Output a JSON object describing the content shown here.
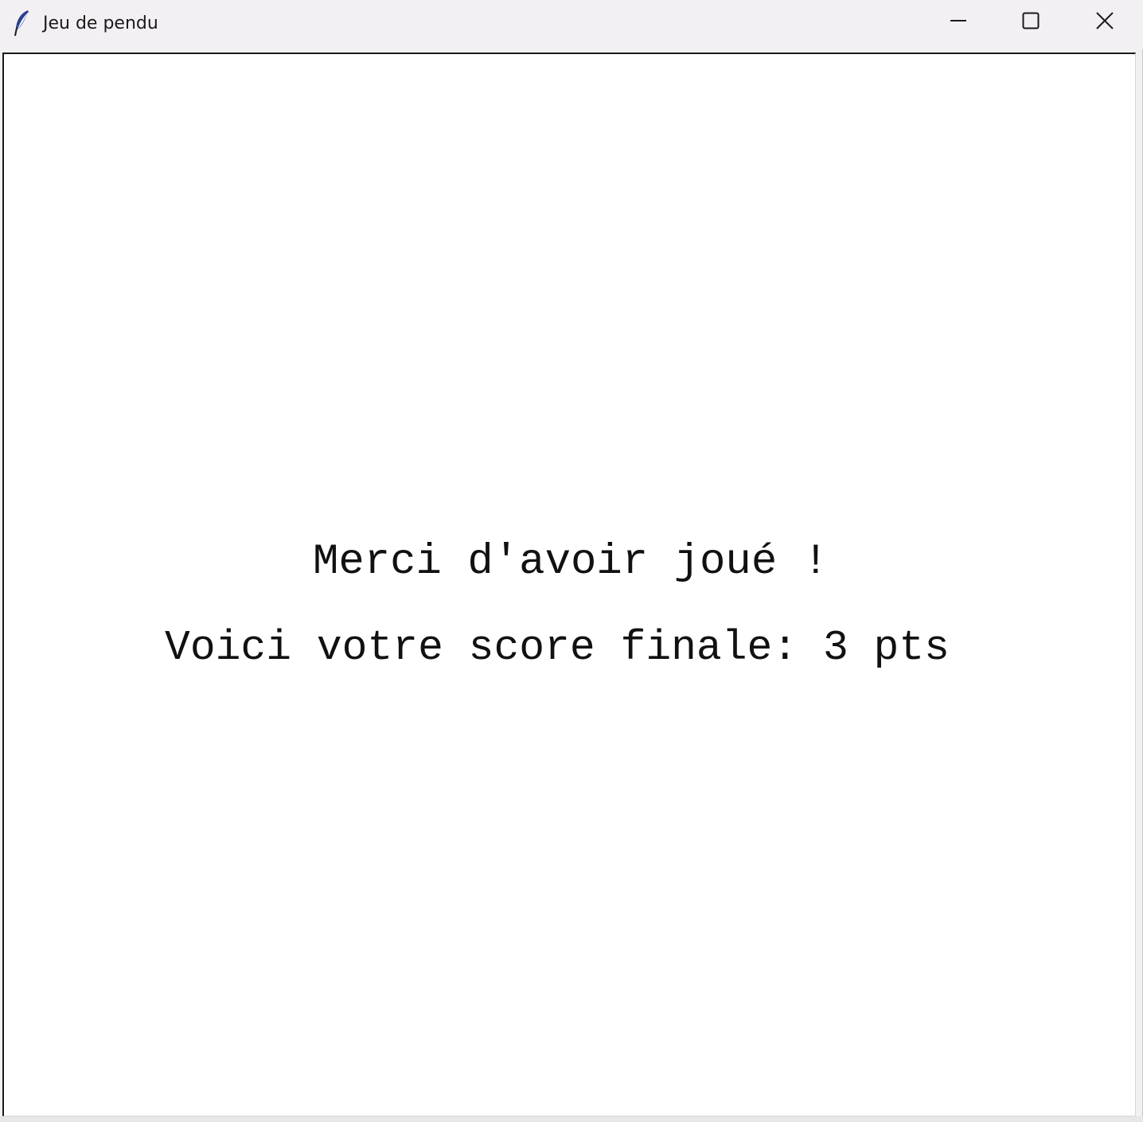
{
  "window": {
    "title": "Jeu de pendu",
    "icon": "feather-icon",
    "controls": {
      "minimize": "minimize-icon",
      "maximize": "maximize-icon",
      "close": "close-icon"
    }
  },
  "canvas": {
    "message": "Merci d'avoir joué !",
    "score_line": "Voici votre score finale: 3 pts"
  },
  "colors": {
    "titlebar": "#f3f0f3",
    "canvas_bg": "#ffffff",
    "text": "#111111"
  }
}
